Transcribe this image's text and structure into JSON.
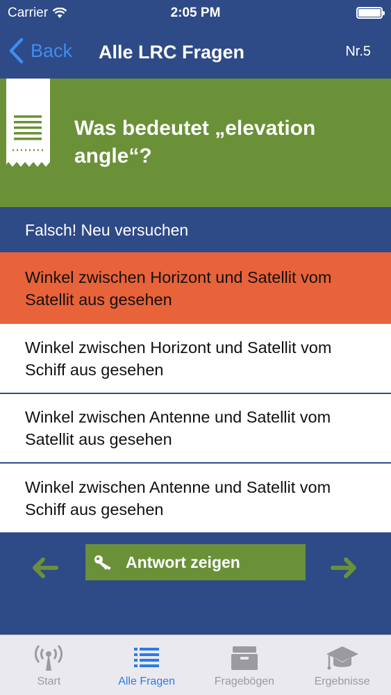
{
  "status": {
    "carrier": "Carrier",
    "time": "2:05 PM"
  },
  "nav": {
    "back_label": "Back",
    "title": "Alle LRC Fragen",
    "number": "Nr.5"
  },
  "question": {
    "text": "Was bedeutet „elevation angle“?"
  },
  "feedback": {
    "text": "Falsch! Neu versuchen"
  },
  "answers": [
    {
      "text": "Winkel zwischen Horizont und Satellit vom Satellit aus gesehen",
      "state": "wrong"
    },
    {
      "text": "Winkel zwischen Horizont und Satellit vom Schiff aus gesehen",
      "state": "neutral"
    },
    {
      "text": "Winkel zwischen Antenne und Satellit vom Satellit aus gesehen",
      "state": "neutral"
    },
    {
      "text": "Winkel zwischen Antenne und Satellit vom Schiff aus gesehen",
      "state": "neutral"
    }
  ],
  "controls": {
    "show_answer_label": "Antwort zeigen",
    "prev_icon": "arrow-left-icon",
    "next_icon": "arrow-right-icon",
    "key_icon": "key-icon"
  },
  "tabs": [
    {
      "label": "Start",
      "icon": "antenna-icon",
      "active": false
    },
    {
      "label": "Alle Fragen",
      "icon": "list-icon",
      "active": true
    },
    {
      "label": "Fragebögen",
      "icon": "archive-box-icon",
      "active": false
    },
    {
      "label": "Ergebnisse",
      "icon": "graduation-cap-icon",
      "active": false
    }
  ],
  "colors": {
    "header_blue": "#2e4a87",
    "question_green": "#6a9137",
    "wrong_orange": "#e8623a",
    "back_blue": "#3f8ef0",
    "tab_active": "#2c7be5",
    "arrow_green": "#6a9137"
  }
}
